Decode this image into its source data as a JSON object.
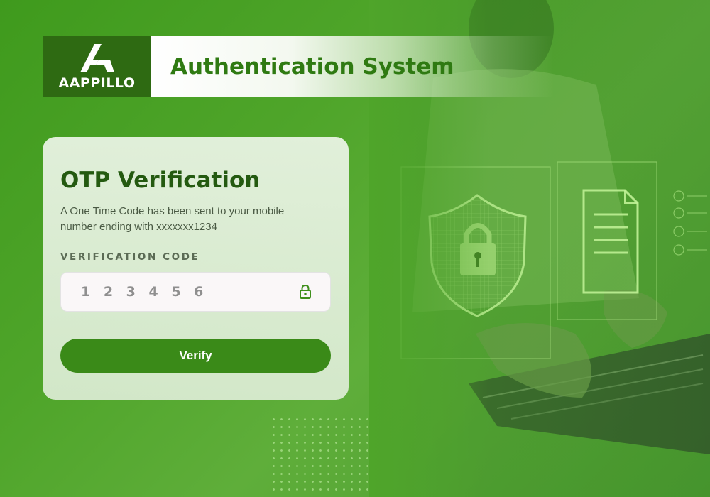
{
  "brand": {
    "logo_text": "AAPPILLO",
    "logo_icon": "letter-a-logo-icon"
  },
  "header": {
    "title": "Authentication System"
  },
  "card": {
    "title": "OTP Verification",
    "description": "A One Time Code has been sent to your mobile number ending with xxxxxxx1234",
    "code_label": "VERIFICATION CODE",
    "code_value": "1 2 3 4 5 6",
    "lock_icon": "lock-icon",
    "verify_label": "Verify"
  },
  "colors": {
    "brand_green": "#2e6a12",
    "title_green": "#2f7a12",
    "button_green": "#3a8a18",
    "background_green": "#4fa52a"
  }
}
